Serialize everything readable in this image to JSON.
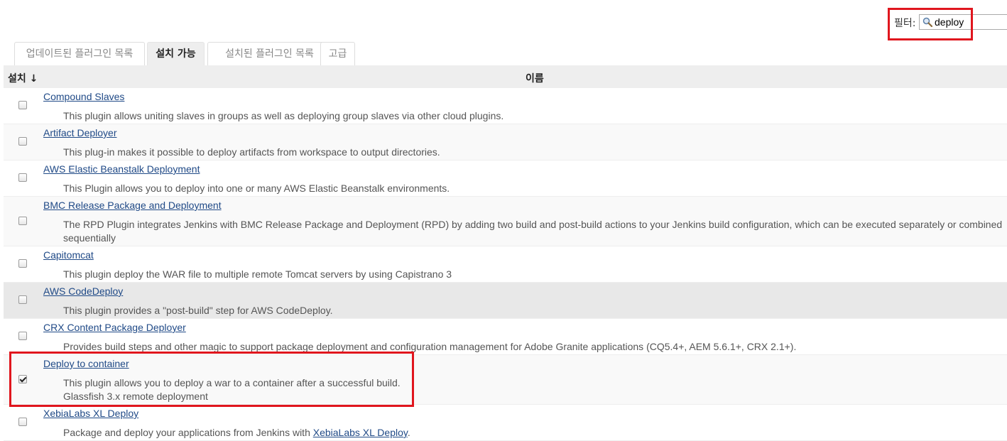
{
  "filter": {
    "label": "필터:",
    "value": "deploy"
  },
  "tabs": [
    {
      "label": "업데이트된 플러그인 목록",
      "active": false
    },
    {
      "label": "설치 가능",
      "active": true
    },
    {
      "label": "설치된 플러그인 목록",
      "active": false
    },
    {
      "label": "고급",
      "active": false
    }
  ],
  "table": {
    "header_install": "설치 ↓",
    "header_name": "이름",
    "rows": [
      {
        "name": "Compound Slaves",
        "desc": "This plugin allows uniting slaves in groups as well as deploying group slaves via other cloud plugins.",
        "checked": false
      },
      {
        "name": "Artifact Deployer",
        "desc": "This plug-in makes it possible to deploy artifacts from workspace to output directories.",
        "checked": false
      },
      {
        "name": "AWS Elastic Beanstalk Deployment",
        "desc": "This Plugin allows you to deploy into one or many AWS Elastic Beanstalk environments.",
        "checked": false
      },
      {
        "name": "BMC Release Package and Deployment",
        "desc": "The RPD Plugin integrates Jenkins with BMC Release Package and Deployment (RPD) by adding two build and post-build actions to your Jenkins build configuration, which can be executed separately or combined sequentially",
        "checked": false
      },
      {
        "name": "Capitomcat",
        "desc": "This plugin deploy the WAR file to multiple remote Tomcat servers by using Capistrano 3",
        "checked": false
      },
      {
        "name": "AWS CodeDeploy",
        "desc": "This plugin provides a \"post-build\" step for AWS CodeDeploy.",
        "checked": false
      },
      {
        "name": "CRX Content Package Deployer",
        "desc": "Provides build steps and other magic to support package deployment and configuration management for Adobe Granite applications (CQ5.4+, AEM 5.6.1+, CRX 2.1+).",
        "checked": false
      },
      {
        "name": "Deploy to container",
        "desc": "This plugin allows you to deploy a war to a container after a successful build.",
        "desc2": "Glassfish 3.x remote deployment",
        "checked": true
      },
      {
        "name": "XebiaLabs XL Deploy",
        "desc": "Package and deploy your applications from Jenkins with ",
        "desc_link": "XebiaLabs XL Deploy",
        "desc_tail": ".",
        "checked": false
      }
    ]
  }
}
